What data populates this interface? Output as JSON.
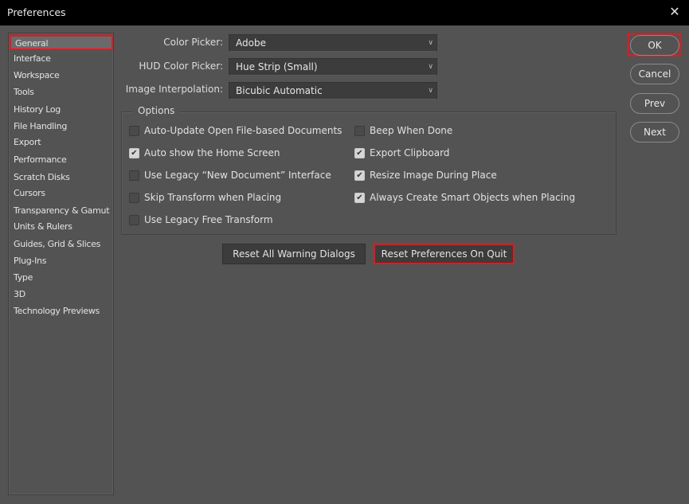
{
  "window": {
    "title": "Preferences",
    "close_icon": "close-icon"
  },
  "sidebar": {
    "items": [
      {
        "label": "General",
        "selected": true
      },
      {
        "label": "Interface"
      },
      {
        "label": "Workspace"
      },
      {
        "label": "Tools"
      },
      {
        "label": "History Log"
      },
      {
        "label": "File Handling"
      },
      {
        "label": "Export"
      },
      {
        "label": "Performance"
      },
      {
        "label": "Scratch Disks"
      },
      {
        "label": "Cursors"
      },
      {
        "label": "Transparency & Gamut"
      },
      {
        "label": "Units & Rulers"
      },
      {
        "label": "Guides, Grid & Slices"
      },
      {
        "label": "Plug-Ins"
      },
      {
        "label": "Type"
      },
      {
        "label": "3D"
      },
      {
        "label": "Technology Previews"
      }
    ]
  },
  "fields": {
    "color_picker": {
      "label": "Color Picker:",
      "value": "Adobe"
    },
    "hud_color_picker": {
      "label": "HUD Color Picker:",
      "value": "Hue Strip (Small)"
    },
    "image_interpolation": {
      "label": "Image Interpolation:",
      "value": "Bicubic Automatic"
    }
  },
  "options": {
    "title": "Options",
    "left": [
      {
        "label": "Auto-Update Open File-based Documents",
        "checked": false
      },
      {
        "label": "Auto show the Home Screen",
        "checked": true
      },
      {
        "label": "Use Legacy “New Document” Interface",
        "checked": false
      },
      {
        "label": "Skip Transform when Placing",
        "checked": false
      },
      {
        "label": "Use Legacy Free Transform",
        "checked": false
      }
    ],
    "right": [
      {
        "label": "Beep When Done",
        "checked": false
      },
      {
        "label": "Export Clipboard",
        "checked": true
      },
      {
        "label": "Resize Image During Place",
        "checked": true
      },
      {
        "label": "Always Create Smart Objects when Placing",
        "checked": true
      }
    ]
  },
  "buttons": {
    "reset_warnings": "Reset All Warning Dialogs",
    "reset_prefs": "Reset Preferences On Quit",
    "ok": "OK",
    "cancel": "Cancel",
    "prev": "Prev",
    "next": "Next"
  },
  "icons": {
    "close": "✕",
    "chevron": "∨",
    "check": "✔"
  },
  "colors": {
    "highlight": "#e8171f",
    "background": "#535353",
    "titlebar": "#000000"
  }
}
